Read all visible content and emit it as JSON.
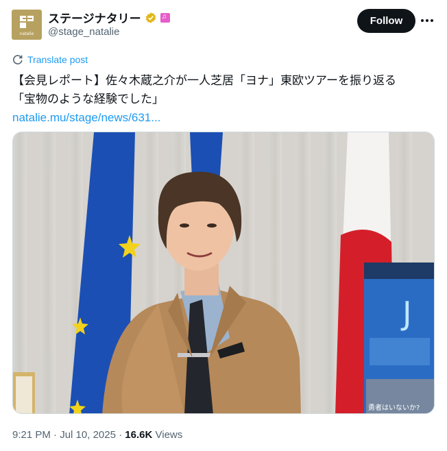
{
  "author": {
    "display_name": "ステージナタリー",
    "handle": "@stage_natalie",
    "avatar_text": "natalie",
    "verified_color": "#e2b719",
    "affiliate_color": "#e55ec9"
  },
  "actions": {
    "follow_label": "Follow",
    "more_icon": "more-horizontal-icon"
  },
  "translate": {
    "label": "Translate post",
    "icon": "translate-icon"
  },
  "post": {
    "line1": "【会見レポート】佐々木蔵之介が一人芝居「ヨナ」東欧ツアーを振り返る",
    "line2": "「宝物のような経験でした」",
    "link": "natalie.mu/stage/news/631..."
  },
  "photo": {
    "alt": "Man in tan suit standing before EU and Japanese flags",
    "poster_headline": "J",
    "poster_tagline": "勇者はいないか?"
  },
  "meta": {
    "time": "9:21 PM",
    "date": "Jul 10, 2025",
    "separator": "·",
    "views_count": "16.6K",
    "views_label": "Views"
  },
  "colors": {
    "accent": "#1d9bf0",
    "text": "#0f1419",
    "muted": "#536471"
  }
}
